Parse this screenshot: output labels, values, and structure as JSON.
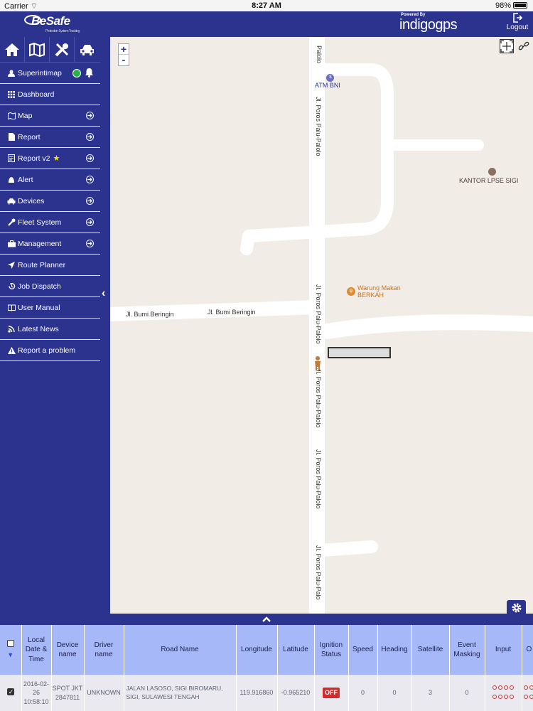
{
  "status_bar": {
    "carrier": "Carrier",
    "time": "8:27 AM",
    "battery": "98%"
  },
  "header": {
    "logo": "BeSafe",
    "logo_sub": "Protection System Tracking",
    "powered_by": "Powered By",
    "powered_name": "indigogps",
    "logout": "Logout"
  },
  "sidebar": {
    "icons": [
      "home-icon",
      "map-icon",
      "tools-icon",
      "car-icon"
    ],
    "user": "Superintimap",
    "items": [
      {
        "label": "Dashboard",
        "icon": "grid-icon",
        "arrow": false
      },
      {
        "label": "Map",
        "icon": "map-icon",
        "arrow": true
      },
      {
        "label": "Report",
        "icon": "document-icon",
        "arrow": true
      },
      {
        "label": "Report v2",
        "icon": "document-icon",
        "arrow": true,
        "star": "★"
      },
      {
        "label": "Alert",
        "icon": "alert-icon",
        "arrow": true
      },
      {
        "label": "Devices",
        "icon": "car-icon",
        "arrow": true
      },
      {
        "label": "Fleet System",
        "icon": "wrench-icon",
        "arrow": true
      },
      {
        "label": "Management",
        "icon": "briefcase-icon",
        "arrow": true
      },
      {
        "label": "Route Planner",
        "icon": "location-arrow-icon",
        "arrow": false
      },
      {
        "label": "Job Dispatch",
        "icon": "history-icon",
        "arrow": false
      },
      {
        "label": "User Manual",
        "icon": "book-icon",
        "arrow": false
      },
      {
        "label": "Latest News",
        "icon": "news-icon",
        "arrow": false
      },
      {
        "label": "Report a problem",
        "icon": "warning-icon",
        "arrow": false
      }
    ]
  },
  "map": {
    "zoom_in": "+",
    "zoom_out": "-",
    "labels": {
      "road_top": "Palolo",
      "road_main_1": "Jl. Poros Palu-Palolo",
      "road_main_2": "Jl. Poros Palu-Palolo",
      "road_main_3": "Jl. Poros Palu-Palolo",
      "road_main_4": "Jl. Poros Palu-Palolo",
      "road_main_5": "Jl. Poros Palu-Palo",
      "road_bumi_1": "Jl. Bumi Beringin",
      "road_bumi_2": "Jl. Bumi Beringin",
      "atm": "ATM BNI",
      "kantor": "KANTOR LPSE SIGI",
      "warung_1": "Warung Makan",
      "warung_2": "BERKAH"
    },
    "colors": {
      "land": "#f1ede6",
      "road": "#ffffff",
      "poi_food": "#c8721e",
      "poi_office": "#4e3e36"
    }
  },
  "table": {
    "headers": [
      "",
      "Local Date & Time",
      "Device name",
      "Driver name",
      "Road Name",
      "Longitude",
      "Latitude",
      "Ignition Status",
      "Speed",
      "Heading",
      "Satellite",
      "Event Masking",
      "Input",
      "O"
    ],
    "row": {
      "datetime": "2016-02-26 10:58:10",
      "device": "SPOT JKT 2847811",
      "driver": "UNKNOWN",
      "road": "JALAN LASOSO, SIGI BIROMARU, SIGI, SULAWESI TENGAH",
      "longitude": "119.916860",
      "latitude": "-0.965210",
      "ignition": "OFF",
      "speed": "0",
      "heading": "0",
      "satellite": "3",
      "event_masking": "0"
    }
  }
}
